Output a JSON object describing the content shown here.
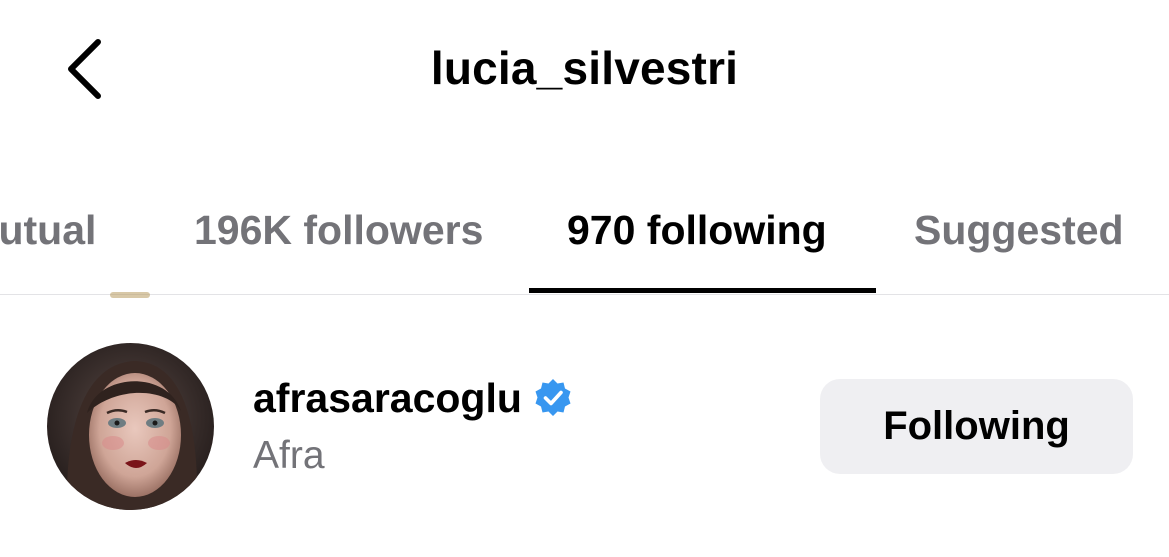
{
  "header": {
    "title": "lucia_silvestri",
    "back_icon": "chevron-left-icon"
  },
  "tabs": [
    {
      "label": "mutual",
      "active": false
    },
    {
      "label": "196K followers",
      "active": false
    },
    {
      "label": "970 following",
      "active": true
    },
    {
      "label": "Suggested",
      "active": false
    }
  ],
  "list": {
    "items": [
      {
        "username": "afrasaracoglu",
        "display_name": "Afra",
        "verified": true,
        "verified_icon": "verified-badge-icon",
        "button_label": "Following"
      }
    ]
  },
  "colors": {
    "verified_badge": "#3897f0",
    "secondary_text": "#737378",
    "button_bg": "#efeff2",
    "active_tab_underline": "#000000"
  }
}
